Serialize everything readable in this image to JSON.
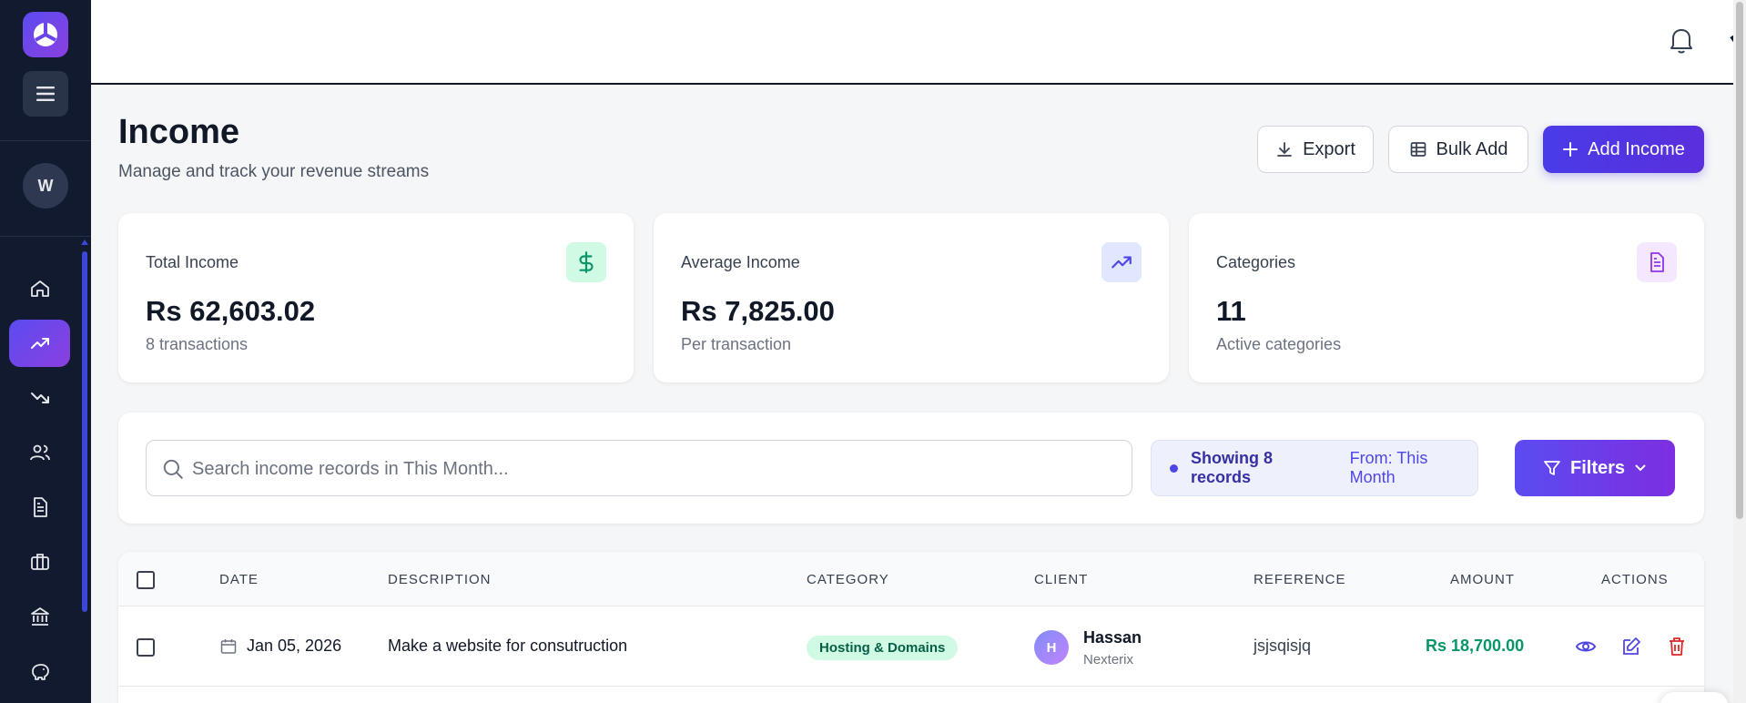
{
  "sidebar": {
    "user_initial": "W",
    "nav": [
      {
        "name": "dashboard",
        "icon": "home-icon"
      },
      {
        "name": "income",
        "icon": "trending-up-icon",
        "active": true
      },
      {
        "name": "expenses",
        "icon": "trending-down-icon"
      },
      {
        "name": "clients",
        "icon": "users-icon"
      },
      {
        "name": "invoices",
        "icon": "document-icon"
      },
      {
        "name": "projects",
        "icon": "briefcase-icon"
      },
      {
        "name": "banking",
        "icon": "bank-icon"
      },
      {
        "name": "savings",
        "icon": "piggy-bank-icon"
      }
    ]
  },
  "header": {
    "title": "Income",
    "subtitle": "Manage and track your revenue streams",
    "export_label": "Export",
    "bulk_add_label": "Bulk Add",
    "add_income_label": "Add Income"
  },
  "stats": [
    {
      "label": "Total Income",
      "value": "Rs 62,603.02",
      "sub": "8 transactions",
      "icon": "dollar-icon",
      "color": "#059669",
      "bg": "#d1fae5"
    },
    {
      "label": "Average Income",
      "value": "Rs 7,825.00",
      "sub": "Per transaction",
      "icon": "trending-up-icon",
      "color": "#4f46e5",
      "bg": "#e0e7ff"
    },
    {
      "label": "Categories",
      "value": "11",
      "sub": "Active categories",
      "icon": "document-icon",
      "color": "#9333ea",
      "bg": "#f3e8ff"
    }
  ],
  "filters": {
    "search_placeholder": "Search income records in This Month...",
    "showing_label": "Showing 8 records",
    "from_label": "From: This Month",
    "filters_label": "Filters"
  },
  "table": {
    "headers": [
      "DATE",
      "DESCRIPTION",
      "CATEGORY",
      "CLIENT",
      "REFERENCE",
      "AMOUNT",
      "ACTIONS"
    ],
    "rows": [
      {
        "date": "Jan 05, 2026",
        "description": "Make a website for consutruction",
        "category": "Hosting & Domains",
        "client_initial": "H",
        "client_name": "Hassan",
        "client_company": "Nexterix",
        "reference": "jsjsqisjq",
        "amount": "Rs 18,700.00"
      }
    ]
  },
  "colors": {
    "sidebar_bg": "#111a2e",
    "accent": "#4f46e5",
    "amount_green": "#059669",
    "delete_red": "#dc2626"
  }
}
